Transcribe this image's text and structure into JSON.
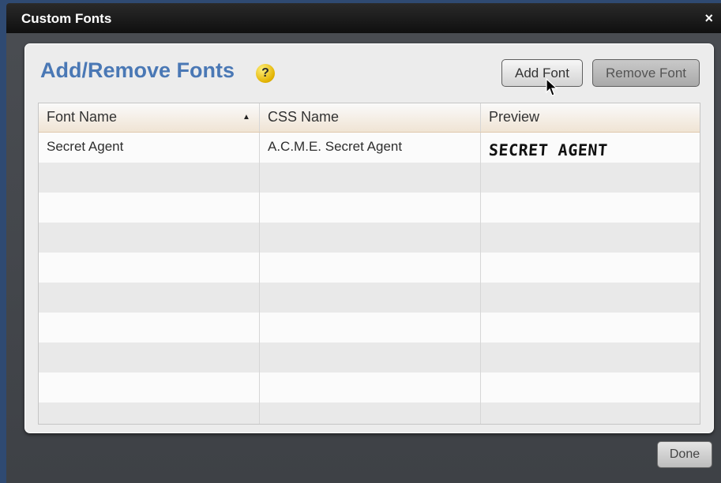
{
  "window": {
    "title": "Custom Fonts",
    "close_label": "×"
  },
  "panel": {
    "title": "Add/Remove Fonts",
    "help_label": "?",
    "buttons": {
      "add_label": "Add Font",
      "remove_label": "Remove Font"
    }
  },
  "table": {
    "columns": [
      "Font Name",
      "CSS Name",
      "Preview"
    ],
    "sort_indicator": "▲",
    "rows": [
      [
        "Secret Agent",
        "A.C.M.E. Secret Agent",
        "SECRET AGENT"
      ]
    ]
  },
  "footer": {
    "done_label": "Done"
  },
  "colors": {
    "title_blue": "#4a78b5",
    "header_tint": "#f0e4d4",
    "help_yellow": "#e2b200"
  },
  "icons": {
    "help": "question-mark-circle-icon",
    "close": "close-icon",
    "sort": "sort-ascending-icon",
    "cursor": "mouse-pointer-icon"
  }
}
